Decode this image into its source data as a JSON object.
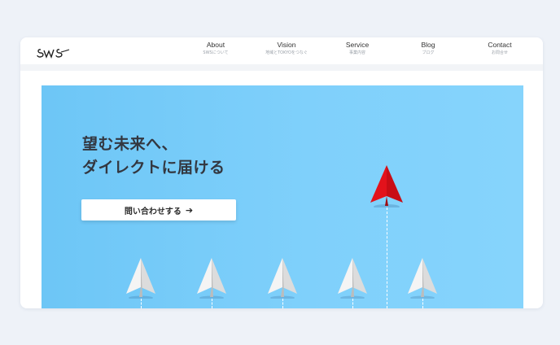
{
  "header": {
    "logo_text": "SWS",
    "nav": [
      {
        "label": "About",
        "sub": "SWSについて"
      },
      {
        "label": "Vision",
        "sub": "地域とTOKYOをつなぐ"
      },
      {
        "label": "Service",
        "sub": "事業内容"
      },
      {
        "label": "Blog",
        "sub": "ブログ"
      },
      {
        "label": "Contact",
        "sub": "お問合せ"
      }
    ]
  },
  "hero": {
    "headline_line1": "望む未来へ、",
    "headline_line2": "ダイレクトに届ける",
    "cta_label": "問い合わせする",
    "cta_arrow": "➔"
  },
  "colors": {
    "hero_bg": "#7ccdf8",
    "lead_plane": "#e3121b",
    "plane": "#ffffff"
  }
}
